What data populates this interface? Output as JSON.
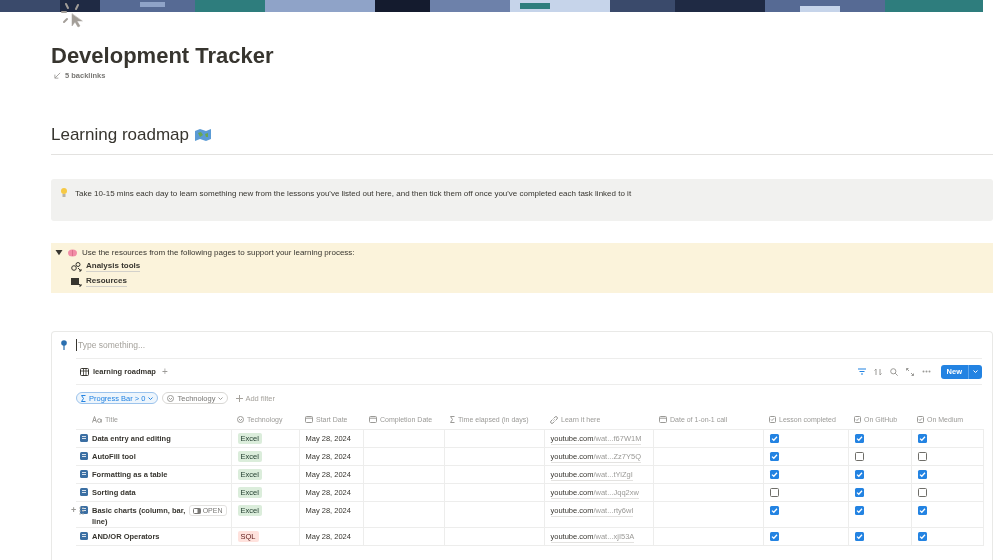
{
  "page": {
    "title": "Development Tracker",
    "backlinks": "5 backlinks"
  },
  "section": {
    "heading": "Learning roadmap"
  },
  "callout": {
    "text": "Take 10-15 mins each day to learn something new from the lessons you've listed out here, and then tick them off once you've completed each task linked to it"
  },
  "toggle": {
    "expanded": true,
    "text": "Use the resources from the following pages to support your learning process:",
    "links": [
      "Analysis tools",
      "Resources"
    ]
  },
  "database": {
    "input": {
      "placeholder": "Type something..."
    },
    "view": {
      "label": "learning roadmap",
      "add": "+"
    },
    "new_button": "New",
    "filters": [
      {
        "label": "Progress Bar > 0",
        "active": true
      },
      {
        "label": "Technology",
        "active": false
      }
    ],
    "add_filter": "Add filter",
    "columns": [
      {
        "label": "Title",
        "kind": "title"
      },
      {
        "label": "Technology",
        "kind": "select"
      },
      {
        "label": "Start Date",
        "kind": "date"
      },
      {
        "label": "Completion Date",
        "kind": "date"
      },
      {
        "label": "Time elapsed (in days)",
        "kind": "formula"
      },
      {
        "label": "Learn it here",
        "kind": "url"
      },
      {
        "label": "Date of 1-on-1 call",
        "kind": "date"
      },
      {
        "label": "Lesson completed",
        "kind": "check"
      },
      {
        "label": "On GitHub",
        "kind": "check"
      },
      {
        "label": "On Medium",
        "kind": "check"
      }
    ],
    "rows": [
      {
        "title": "Data entry and editing",
        "tag": {
          "label": "Excel",
          "color": "#dbeddb"
        },
        "start": "May 28, 2024",
        "url_host": "youtube.com",
        "url_path": "/wat...f67W1M",
        "lesson": true,
        "github": true,
        "medium": true,
        "hovered": false
      },
      {
        "title": "AutoFill tool",
        "tag": {
          "label": "Excel",
          "color": "#dbeddb"
        },
        "start": "May 28, 2024",
        "url_host": "youtube.com",
        "url_path": "/wat...Zz7Y5Q",
        "lesson": true,
        "github": false,
        "medium": false,
        "hovered": false
      },
      {
        "title": "Formatting as a table",
        "tag": {
          "label": "Excel",
          "color": "#dbeddb"
        },
        "start": "May 28, 2024",
        "url_host": "youtube.com",
        "url_path": "/wat...tYiZgI",
        "lesson": true,
        "github": true,
        "medium": true,
        "hovered": false
      },
      {
        "title": "Sorting data",
        "tag": {
          "label": "Excel",
          "color": "#dbeddb"
        },
        "start": "May 28, 2024",
        "url_host": "youtube.com",
        "url_path": "/wat...Jqq2xw",
        "lesson": false,
        "github": true,
        "medium": false,
        "hovered": false
      },
      {
        "title": "Basic charts (column, bar, line)",
        "tag": {
          "label": "Excel",
          "color": "#dbeddb"
        },
        "start": "May 28, 2024",
        "url_host": "youtube.com",
        "url_path": "/wat...rty6wI",
        "lesson": true,
        "github": true,
        "medium": true,
        "hovered": true,
        "open_label": "OPEN",
        "add": "+"
      },
      {
        "title": "AND/OR Operators",
        "tag": {
          "label": "SQL",
          "color": "#ffe2dd"
        },
        "start": "May 28, 2024",
        "url_host": "youtube.com",
        "url_path": "/wat...xjI53A",
        "lesson": true,
        "github": true,
        "medium": true,
        "hovered": false
      }
    ]
  }
}
